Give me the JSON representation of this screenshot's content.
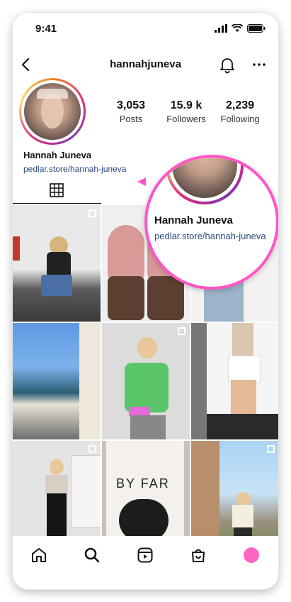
{
  "status_bar": {
    "time": "9:41"
  },
  "header": {
    "username": "hannahjuneva"
  },
  "profile": {
    "stats": [
      {
        "value": "3,053",
        "label": "Posts"
      },
      {
        "value": "15.9 k",
        "label": "Followers"
      },
      {
        "value": "2,239",
        "label": "Following"
      }
    ],
    "name": "Hannah Juneva",
    "link": "pedlar.store/hannah-juneva"
  },
  "magnifier": {
    "name": "Hannah Juneva",
    "link": "pedlar.store/hannah-juneva"
  },
  "grid_posts": [
    {
      "desc": "woman sitting on curb"
    },
    {
      "desc": "pink clogs"
    },
    {
      "desc": "person in white tank"
    },
    {
      "desc": "beach coastline"
    },
    {
      "desc": "green vest outfit"
    },
    {
      "desc": "white skirt legs"
    },
    {
      "desc": "black flares outfit"
    },
    {
      "desc": "BY FAR poster"
    },
    {
      "desc": "street walk"
    }
  ],
  "poster_text": {
    "brand": "BY FAR"
  },
  "nav": [
    "home-icon",
    "search-icon",
    "reels-icon",
    "shop-icon",
    "profile-avatar"
  ],
  "colors": {
    "accent": "#ff55c8",
    "link": "#2c4a7c",
    "profile_dot": "#ff66c4"
  }
}
